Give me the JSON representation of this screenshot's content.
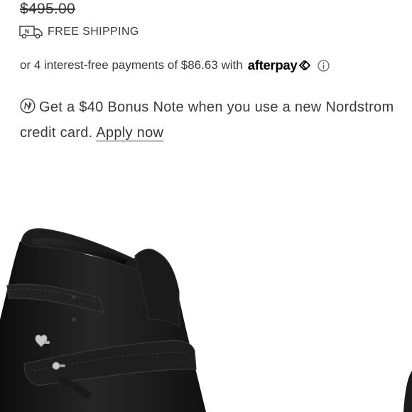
{
  "price": {
    "original": "$495.00"
  },
  "shipping": {
    "icon": "delivery-truck-icon",
    "truck_letter": "N",
    "label": "FREE SHIPPING"
  },
  "afterpay": {
    "text": "or 4 interest-free payments of $86.63 with",
    "logo_text": "afterpay",
    "info_icon": "info-icon"
  },
  "bonus_note": {
    "icon": "nordstrom-note-icon",
    "text": "Get a $40 Bonus Note when you use a new Nordstrom credit card.",
    "link_label": "Apply now"
  },
  "product": {
    "image": "black-leather-ankle-boot",
    "colors": {
      "leather": "#141414",
      "hardware": "#c9c9c9"
    }
  }
}
